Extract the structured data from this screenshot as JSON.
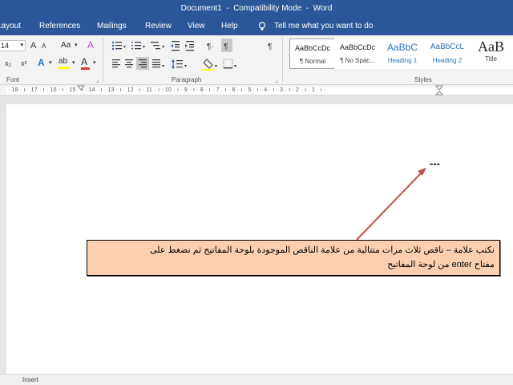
{
  "window": {
    "title": "Document1  -  Compatibility Mode  -  Word"
  },
  "tabs": [
    "Layout",
    "References",
    "Mailings",
    "Review",
    "View",
    "Help"
  ],
  "tell_me": {
    "placeholder": "Tell me what you want to do",
    "icon": "lightbulb-icon"
  },
  "ribbon": {
    "font": {
      "size": "14",
      "label": "Font",
      "grow": "A",
      "shrink": "A",
      "case": "Aa",
      "clear": "A",
      "subscript": "x₂",
      "superscript": "x²",
      "effects": "A",
      "highlight": "ab",
      "color": "A",
      "launcher": "⌟"
    },
    "paragraph": {
      "label": "Paragraph",
      "pilcrow": "¶",
      "launcher": "⌟"
    },
    "styles": {
      "label": "Styles",
      "items": [
        {
          "preview": "AaBbCcDc",
          "name": "¶ Normal"
        },
        {
          "preview": "AaBbCcDc",
          "name": "¶ No Spac..."
        },
        {
          "preview": "AaBbC",
          "name": "Heading 1"
        },
        {
          "preview": "AaBbCcL",
          "name": "Heading 2"
        },
        {
          "preview": "AaB",
          "name": "Title"
        }
      ]
    }
  },
  "ruler": {
    "numbers": "· 18 · ı · 17 · ı · 16 · ı · 15 · ı · 14 · ı · 13 · ı · 12 · ı · 11 · ı · 10 · ı · 9 · ı · 8 · ı · 7 · ı · 6 · ı · 5 · ı · 4 · ı · 3 · ı · 2 · ı · 1 · ı ·"
  },
  "document": {
    "typed_text": "---",
    "callout_line1": "نكتب علامة – ناقص ثلاث مرات متتالية من علامة الناقص الموجودة بلوحة المفاتيح ثم نضغط على",
    "callout_line2": "مفتاح enter من لوحة المفاتيح"
  },
  "status": {
    "mode": "Insert"
  },
  "colors": {
    "titlebar": "#2b579a",
    "callout_fill": "#fbcfb0",
    "arrow": "#c0504d",
    "font_color_bar": "#e03c31",
    "highlight_bar": "#ffff00"
  }
}
